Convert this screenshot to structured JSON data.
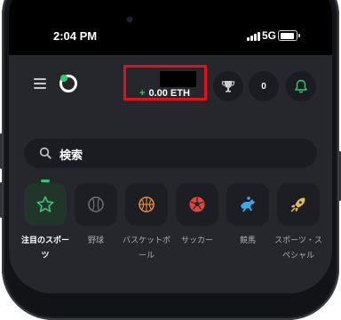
{
  "status_bar": {
    "time": "2:04 PM",
    "network": "5G"
  },
  "header": {
    "balance": "0.00 ETH",
    "balance_prefix": "+",
    "notification_count": "0",
    "accent_color": "#2ecc71",
    "highlight_color": "#e3101a"
  },
  "search": {
    "placeholder": "検索"
  },
  "categories": [
    {
      "label": "注目のスポーツ",
      "icon": "star-icon",
      "active": true
    },
    {
      "label": "野球",
      "icon": "baseball-icon",
      "active": false
    },
    {
      "label": "バスケットボール",
      "icon": "basketball-icon",
      "active": false
    },
    {
      "label": "サッカー",
      "icon": "soccer-ball-icon",
      "active": false
    },
    {
      "label": "競馬",
      "icon": "horse-racing-icon",
      "active": false
    },
    {
      "label": "スポーツ・スペシャル",
      "icon": "rocket-icon",
      "active": false
    }
  ]
}
